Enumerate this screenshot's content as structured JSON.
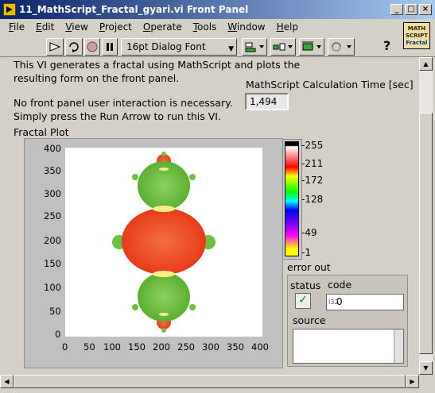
{
  "window": {
    "title": "11_MathScript_Fractal_gyari.vi Front Panel",
    "controls": [
      "_",
      "□",
      "×"
    ]
  },
  "menubar": [
    "File",
    "Edit",
    "View",
    "Project",
    "Operate",
    "Tools",
    "Window",
    "Help"
  ],
  "toolbar": {
    "font_label": "16pt Dialog Font",
    "vi_icon_text": [
      "MATH",
      "SCRIPT",
      "Fractal"
    ],
    "help": "?"
  },
  "description": {
    "line1": "This VI generates a fractal using MathScript and plots the",
    "line2": "resulting form on the front panel.",
    "line3": "No front panel user interaction is necessary.",
    "line4": "Simply press the Run Arrow to run this VI."
  },
  "calc_time": {
    "label": "MathScript Calculation Time [sec]",
    "value": "1,494"
  },
  "plot": {
    "label": "Fractal Plot",
    "x_ticks": [
      "0",
      "50",
      "100",
      "150",
      "200",
      "250",
      "300",
      "350",
      "400"
    ],
    "y_ticks": [
      "400",
      "350",
      "300",
      "250",
      "200",
      "150",
      "100",
      "50",
      "0"
    ]
  },
  "colorbar": {
    "labels": [
      "255",
      "211",
      "172",
      "128",
      "49",
      "1"
    ]
  },
  "error_out": {
    "label": "error out",
    "status_label": "status",
    "code_label": "code",
    "code_value": "0",
    "code_type": "I32",
    "source_label": "source",
    "status_mark": "✓"
  },
  "colors": {
    "fractal_red": "#ee4422",
    "fractal_green": "#6cc040",
    "fractal_yellow": "#ffee88"
  }
}
